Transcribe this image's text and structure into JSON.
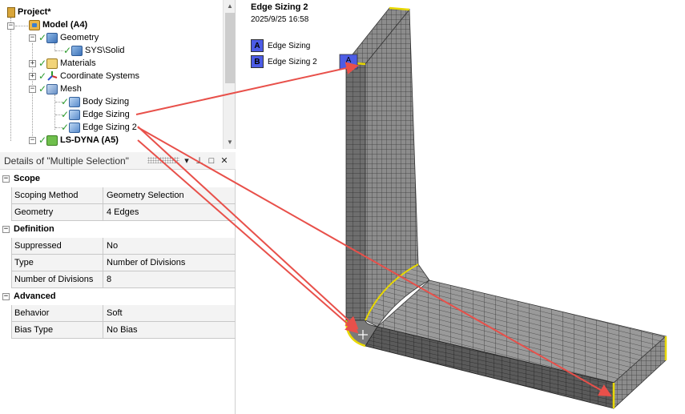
{
  "tree": {
    "project": "Project*",
    "model": "Model (A4)",
    "geometry": "Geometry",
    "sys_solid": "SYS\\Solid",
    "materials": "Materials",
    "coordinate_systems": "Coordinate Systems",
    "mesh": "Mesh",
    "body_sizing": "Body Sizing",
    "edge_sizing": "Edge Sizing",
    "edge_sizing_2": "Edge Sizing 2",
    "lsdyna": "LS-DYNA (A5)"
  },
  "details": {
    "title": "Details of \"Multiple Selection\"",
    "sections": [
      {
        "title": "Scope",
        "rows": [
          {
            "key": "Scoping Method",
            "value": "Geometry Selection"
          },
          {
            "key": "Geometry",
            "value": "4 Edges"
          }
        ]
      },
      {
        "title": "Definition",
        "rows": [
          {
            "key": "Suppressed",
            "value": "No"
          },
          {
            "key": "Type",
            "value": "Number of Divisions"
          },
          {
            "key": "Number of Divisions",
            "value": "8"
          }
        ]
      },
      {
        "title": "Advanced",
        "rows": [
          {
            "key": "Behavior",
            "value": "Soft"
          },
          {
            "key": "Bias Type",
            "value": "No Bias"
          }
        ]
      }
    ]
  },
  "viewport": {
    "title": "Edge Sizing 2",
    "date": "2025/9/25 16:58",
    "legend": [
      {
        "key": "A",
        "label": "Edge Sizing"
      },
      {
        "key": "B",
        "label": "Edge Sizing 2"
      }
    ],
    "marker": "A",
    "colors": {
      "legend": "#4c5ce6",
      "arrow": "#e8504a",
      "mesh_face": "#888888",
      "mesh_dark": "#3a3a3a",
      "edge_highlight": "#e8d800"
    }
  }
}
